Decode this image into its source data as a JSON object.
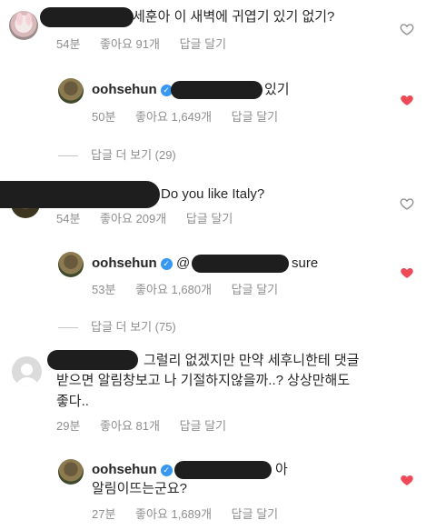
{
  "comments": [
    {
      "text": "세훈아 이 새벽에 귀엽기 있기 없기?",
      "time": "54분",
      "likes": "좋아요 91개",
      "reply": "답글 달기",
      "liked": false,
      "reply_item": {
        "username": "oohsehun",
        "text": "있기",
        "time": "50분",
        "likes": "좋아요 1,649개",
        "reply": "답글 달기",
        "liked": true
      },
      "view_more": "답글 더 보기 (29)"
    },
    {
      "text": "Do you like Italy?",
      "time": "54분",
      "likes": "좋아요 209개",
      "reply": "답글 달기",
      "liked": false,
      "reply_item": {
        "username": "oohsehun",
        "mention": "@",
        "text": "sure",
        "time": "53분",
        "likes": "좋아요 1,680개",
        "reply": "답글 달기",
        "liked": true
      },
      "view_more": "답글 더 보기 (75)"
    },
    {
      "text_line1": "그럴리 없겠지만 만약 세후니한테 댓글",
      "text_line2": "받으면 알림창보고 나 기절하지않을까..? 상상만해도",
      "text_line3": "좋다..",
      "time": "29분",
      "likes": "좋아요 81개",
      "reply": "답글 달기",
      "liked": false,
      "reply_item": {
        "username": "oohsehun",
        "text_line1": "아",
        "text_line2": "알림이뜨는군요?",
        "time": "27분",
        "likes": "좋아요 1,689개",
        "reply": "답글 달기",
        "liked": true
      }
    }
  ],
  "colors": {
    "heart_liked": "#ed4956",
    "heart_outline": "#8e8e8e",
    "verified": "#3897f0",
    "meta": "#8e8e8e"
  }
}
